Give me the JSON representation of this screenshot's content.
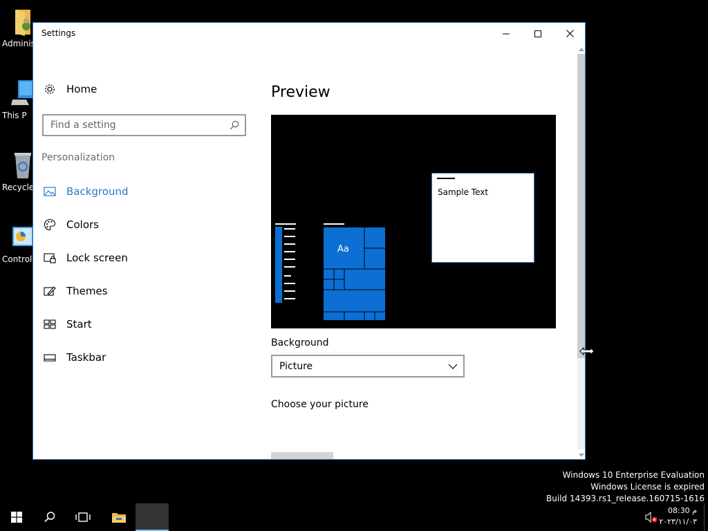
{
  "desktop": {
    "icons": [
      {
        "label": "Administ",
        "icon": "user-folder-icon"
      },
      {
        "label": "This P",
        "icon": "this-pc-icon"
      },
      {
        "label": "Recycle",
        "icon": "recycle-bin-icon"
      },
      {
        "label": "Control",
        "icon": "control-panel-icon"
      }
    ]
  },
  "window": {
    "title": "Settings",
    "controls": {
      "minimize": "minimize-icon",
      "maximize": "maximize-icon",
      "close": "close-icon"
    }
  },
  "nav": {
    "home_label": "Home",
    "search_placeholder": "Find a setting",
    "section_title": "Personalization",
    "items": [
      {
        "label": "Background",
        "icon": "picture-icon",
        "active": true
      },
      {
        "label": "Colors",
        "icon": "palette-icon",
        "active": false
      },
      {
        "label": "Lock screen",
        "icon": "lock-screen-icon",
        "active": false
      },
      {
        "label": "Themes",
        "icon": "themes-icon",
        "active": false
      },
      {
        "label": "Start",
        "icon": "start-tiles-icon",
        "active": false
      },
      {
        "label": "Taskbar",
        "icon": "taskbar-icon",
        "active": false
      }
    ]
  },
  "content": {
    "heading": "Preview",
    "preview": {
      "sample_text": "Sample Text",
      "tile_label": "Aa"
    },
    "background_label": "Background",
    "background_value": "Picture",
    "choose_label": "Choose your picture"
  },
  "watermark": {
    "line1": "Windows 10 Enterprise Evaluation",
    "line2": "Windows License is expired",
    "line3": "Build 14393.rs1_release.160715-1616"
  },
  "taskbar": {
    "buttons": [
      "start-icon",
      "search-icon",
      "task-view-icon",
      "file-explorer-icon",
      "settings-app-icon"
    ],
    "clock_time": "08:30 م",
    "clock_date": "۲۰۲۳/۱۱/۰۳"
  },
  "colors": {
    "accent": "#2b78c6",
    "tile_blue": "#0b6fd4"
  }
}
